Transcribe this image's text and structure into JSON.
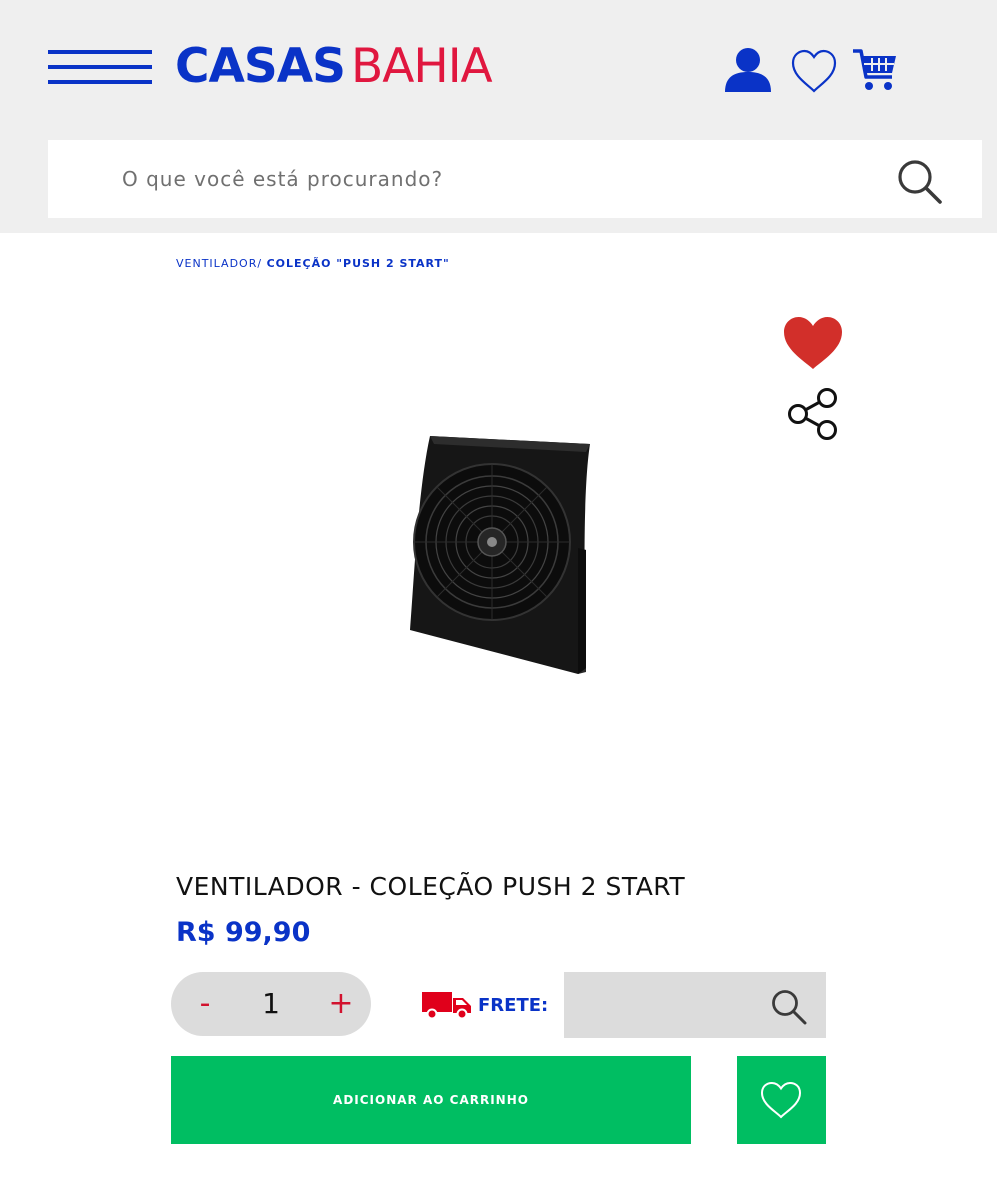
{
  "header": {
    "logo_part1": "CASAS",
    "logo_part2": "BAHIA",
    "icons": [
      "menu-icon",
      "user-icon",
      "heart-icon",
      "cart-icon"
    ]
  },
  "search": {
    "placeholder": "O que você está procurando?"
  },
  "breadcrumb": {
    "parent": "VENTILADOR/",
    "current": "COLEÇÃO \"PUSH 2 START\""
  },
  "product": {
    "title": "VENTILADOR - COLEÇÃO PUSH 2 START",
    "price": "R$ 99,90",
    "image": "black-box-fan",
    "favorited": true
  },
  "quantity": {
    "minus": "-",
    "value": "1",
    "plus": "+"
  },
  "shipping": {
    "label": "FRETE:",
    "cep_value": ""
  },
  "actions": {
    "add_to_cart": "ADICIONAR AO CARRINHO"
  },
  "colors": {
    "brand_blue": "#0a33c7",
    "brand_red": "#e0173f",
    "favorite_red": "#d22f2a",
    "cta_green": "#00be62",
    "header_bg": "#efefef"
  }
}
